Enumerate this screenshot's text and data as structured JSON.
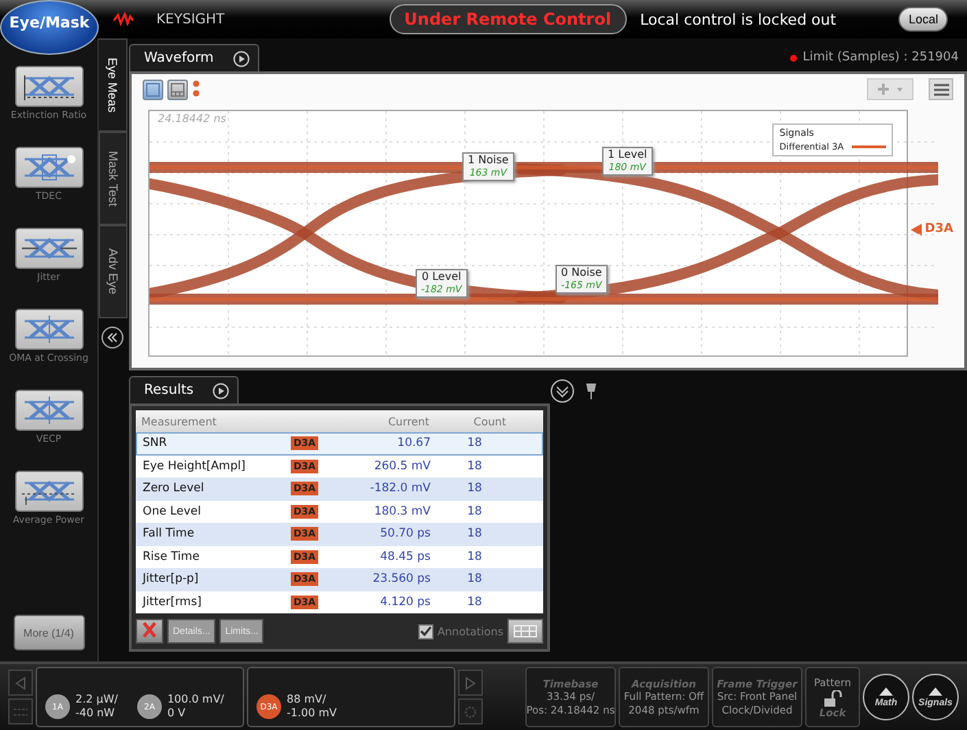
{
  "header": {
    "mode_button": "Eye/Mask",
    "brand": "KEYSIGHT",
    "remote_status": "Under Remote Control",
    "lock_message": "Local control is locked out",
    "local_button": "Local"
  },
  "sidebar": {
    "tools": [
      {
        "label": "Extinction Ratio",
        "kind": "extinction"
      },
      {
        "label": "TDEC",
        "kind": "tdec"
      },
      {
        "label": "Jitter",
        "kind": "jitter"
      },
      {
        "label": "OMA at Crossing",
        "kind": "oma"
      },
      {
        "label": "VECP",
        "kind": "vecp"
      },
      {
        "label": "Average Power",
        "kind": "power"
      }
    ],
    "more_button": "More (1/4)"
  },
  "vertical_tabs": [
    {
      "label": "Eye Meas",
      "selected": true
    },
    {
      "label": "Mask Test",
      "selected": false
    },
    {
      "label": "Adv Eye",
      "selected": false
    }
  ],
  "waveform": {
    "tab": "Waveform",
    "limit": "Limit (Samples) : 251904",
    "view_buttons": [
      {
        "kind": "single",
        "selected": true
      },
      {
        "kind": "grid",
        "selected": false
      }
    ],
    "time_stamp": "24.18442 ns",
    "legend": {
      "title": "Signals",
      "entries": [
        {
          "name": "Differential 3A",
          "color": "#e0602e"
        }
      ]
    },
    "annotations": [
      {
        "title": "1 Noise",
        "value": "163 mV"
      },
      {
        "title": "1 Level",
        "value": "180 mV"
      },
      {
        "title": "0 Level",
        "value": "-182 mV"
      },
      {
        "title": "0 Noise",
        "value": "-165 mV"
      }
    ],
    "channel_marker": "D3A"
  },
  "results": {
    "tab": "Results",
    "columns": [
      "Measurement",
      "Current",
      "Count"
    ],
    "rows": [
      {
        "name": "SNR",
        "source": "D3A",
        "current": "10.67",
        "count": "18",
        "selected": true
      },
      {
        "name": "Eye Height[Ampl]",
        "source": "D3A",
        "current": "260.5 mV",
        "count": "18",
        "selected": false
      },
      {
        "name": "Zero Level",
        "source": "D3A",
        "current": "-182.0 mV",
        "count": "18",
        "selected": false
      },
      {
        "name": "One Level",
        "source": "D3A",
        "current": "180.3 mV",
        "count": "18",
        "selected": false
      },
      {
        "name": "Fall Time",
        "source": "D3A",
        "current": "50.70 ps",
        "count": "18",
        "selected": false
      },
      {
        "name": "Rise Time",
        "source": "D3A",
        "current": "48.45 ps",
        "count": "18",
        "selected": false
      },
      {
        "name": "Jitter[p-p]",
        "source": "D3A",
        "current": "23.560 ps",
        "count": "18",
        "selected": false
      },
      {
        "name": "Jitter[rms]",
        "source": "D3A",
        "current": "4.120 ps",
        "count": "18",
        "selected": false
      }
    ],
    "buttons": [
      {
        "label": "Details...",
        "disabled": true
      },
      {
        "label": "Limits...",
        "disabled": true
      }
    ],
    "annotations_toggle": {
      "label": "Annotations",
      "checked": true
    }
  },
  "bottom_bar": {
    "channel_groups": [
      {
        "channels": [
          {
            "badge": "1A",
            "scale": "2.2 µW/",
            "offset": "-40 nW",
            "color": "#9a9a9a"
          },
          {
            "badge": "2A",
            "scale": "100.0 mV/",
            "offset": "0 V",
            "color": "#9a9a9a"
          }
        ]
      },
      {
        "channels": [
          {
            "badge": "D3A",
            "scale": "88 mV/",
            "offset": "-1.00 mV",
            "color": "#d8562c"
          }
        ]
      }
    ],
    "timebase": {
      "title": "Timebase",
      "lines": [
        "33.34 ps/",
        "Pos: 24.18442 ns"
      ]
    },
    "acquisition": {
      "title": "Acquisition",
      "lines": [
        "Full Pattern: Off",
        "2048 pts/wfm"
      ]
    },
    "trigger": {
      "title": "Frame Trigger",
      "lines": [
        "Src: Front Panel",
        "Clock/Divided"
      ]
    },
    "pattern": {
      "title": "Pattern",
      "action": "Lock"
    },
    "round_buttons": [
      "Math",
      "Signals"
    ]
  }
}
